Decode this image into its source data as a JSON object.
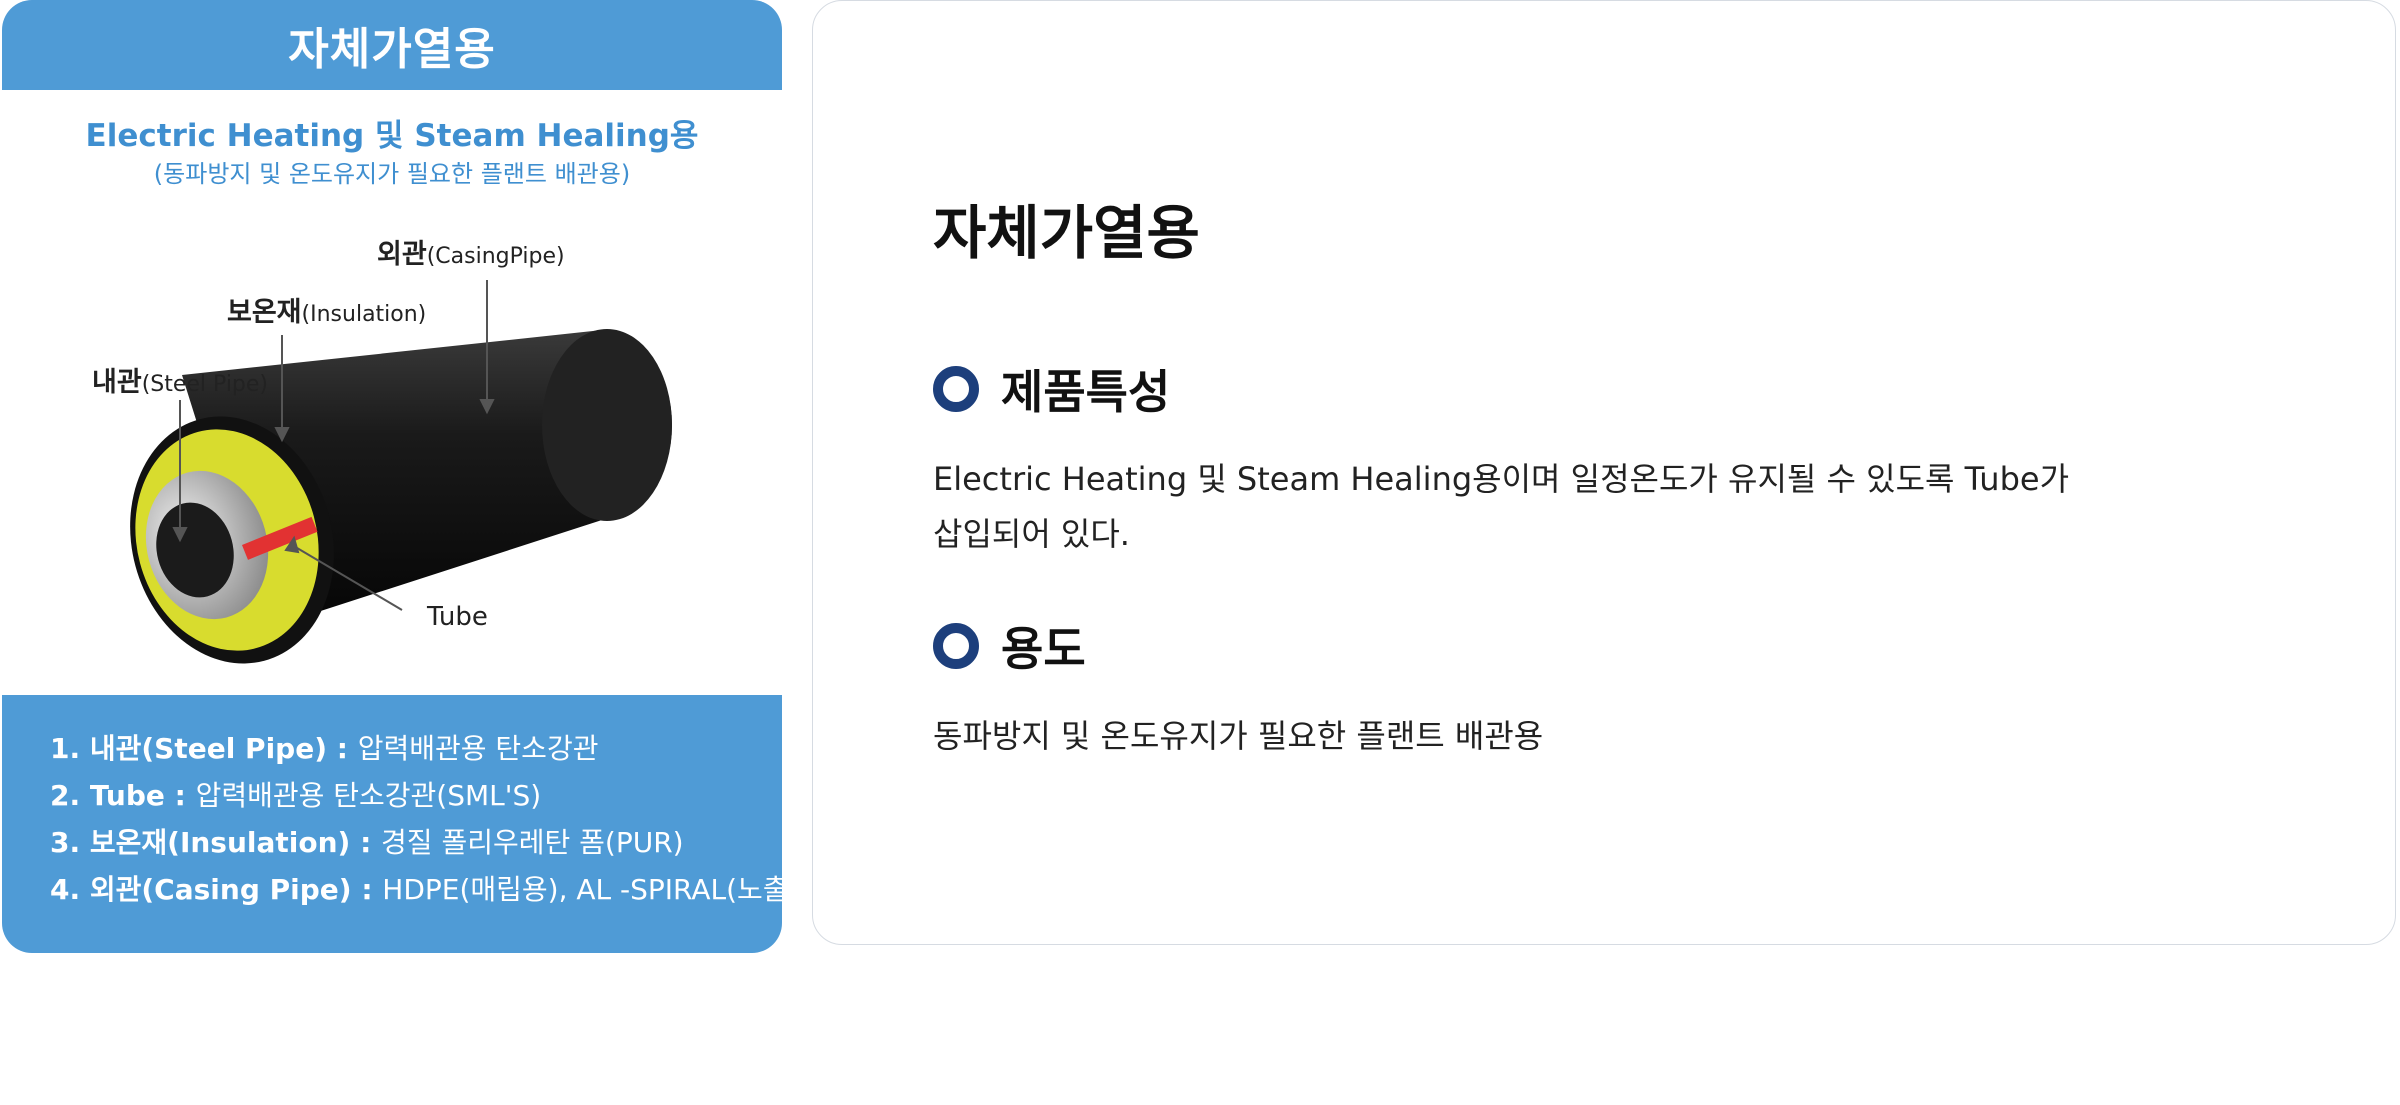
{
  "left_card": {
    "header_title": "자체가열용",
    "figure": {
      "subtitle_line1": "Electric Heating 및 Steam Healing용",
      "subtitle_line2": "(동파방지 및 온도유지가 필요한 플랜트 배관용)",
      "callouts": {
        "casing_ko": "외관",
        "casing_en": "(CasingPipe)",
        "insulation_ko": "보온재",
        "insulation_en": "(Insulation)",
        "steel_ko": "내관",
        "steel_en": "(Steel Pipe)",
        "tube": "Tube"
      }
    },
    "specs": [
      {
        "label": "1. 내관(Steel Pipe) : ",
        "value": "압력배관용 탄소강관"
      },
      {
        "label": "2. Tube : ",
        "value": "압력배관용 탄소강관(SML'S)"
      },
      {
        "label": "3. 보온재(Insulation) : ",
        "value": "경질 폴리우레탄 폼(PUR)"
      },
      {
        "label": "4. 외관(Casing Pipe) : ",
        "value": "HDPE(매립용), AL -SPIRAL(노출용)"
      }
    ]
  },
  "right_card": {
    "title": "자체가열용",
    "sections": [
      {
        "title": "제품특성",
        "body": "Electric Heating 및 Steam Healing용이며 일정온도가 유지될 수 있도록 Tube가 삽입되어 있다."
      },
      {
        "title": "용도",
        "body": "동파방지 및 온도유지가 필요한 플랜트 배관용"
      }
    ]
  },
  "colors": {
    "card_blue": "#4f9bd6",
    "bullet_navy": "#1d3f7c"
  },
  "icons": {
    "section_bullet": "ring-bullet-icon"
  }
}
